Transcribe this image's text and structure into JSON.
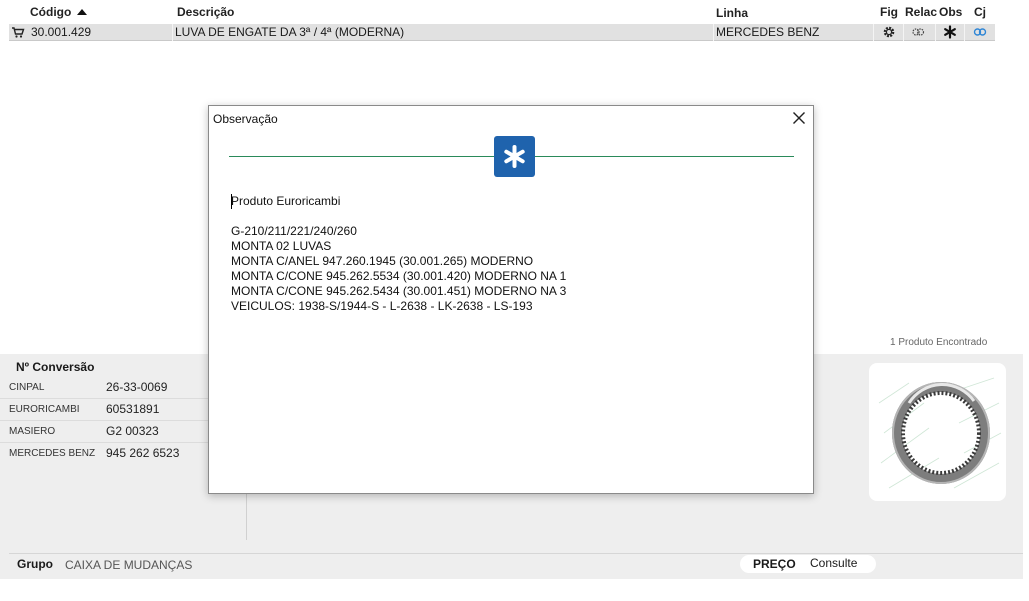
{
  "table": {
    "headers": {
      "codigo": "Código",
      "descricao": "Descrição",
      "linha": "Linha",
      "fig": "Fig",
      "relac": "Relac",
      "obs": "Obs",
      "cj": "Cj"
    },
    "row": {
      "codigo": "30.001.429",
      "descricao": "LUVA DE ENGATE DA 3ª / 4ª (MODERNA)",
      "linha": "MERCEDES BENZ",
      "icons": [
        "cart-icon",
        "gear-icon",
        "relation-icon",
        "asterisk-icon",
        "link-icon"
      ]
    }
  },
  "results": {
    "found_text": "1 Produto Encontrado"
  },
  "conversion": {
    "title": "Nº Conversão",
    "items": [
      {
        "name": "CINPAL",
        "value": "26-33-0069"
      },
      {
        "name": "EURORICAMBI",
        "value": "60531891"
      },
      {
        "name": "MASIERO",
        "value": "G2 00323"
      },
      {
        "name": "MERCEDES BENZ",
        "value": "945 262 6523"
      }
    ]
  },
  "footer": {
    "grupo_label": "Grupo",
    "grupo_value": "CAIXA DE MUDANÇAS",
    "preco_label": "PREÇO",
    "preco_value": "Consulte"
  },
  "modal": {
    "title": "Observação",
    "lines": [
      "Produto Euroricambi",
      "",
      "G-210/211/221/240/260",
      "MONTA 02 LUVAS",
      "MONTA C/ANEL 947.260.1945 (30.001.265) MODERNO",
      "MONTA C/CONE 945.262.5534 (30.001.420) MODERNO NA 1",
      "MONTA C/CONE 945.262.5434 (30.001.451) MODERNO NA 3",
      "VEICULOS: 1938-S/1944-S - L-2638 - LK-2638 - LS-193"
    ]
  },
  "colors": {
    "accent_blue": "#1f63ad",
    "divider_green": "#2a8a5a",
    "row_selected": "#e1e1e1",
    "panel_gray": "#eeeeee"
  }
}
